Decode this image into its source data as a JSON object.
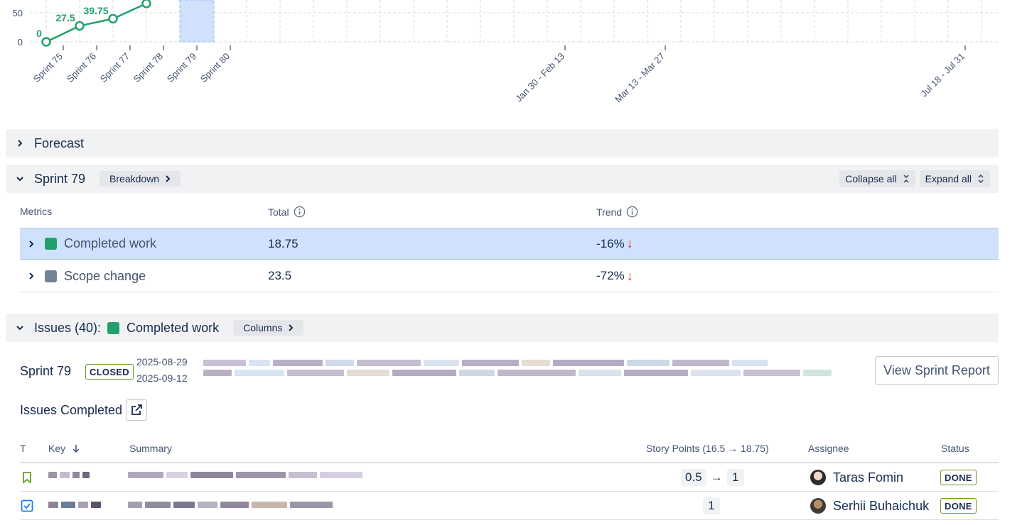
{
  "chart_data": {
    "type": "line",
    "series": [
      {
        "name": "Completed work",
        "color": "#22a06b",
        "x": [
          "Sprint 75",
          "Sprint 76",
          "Sprint 77",
          "Sprint 78"
        ],
        "y": [
          0,
          27.5,
          39.75,
          66
        ]
      }
    ],
    "data_labels": [
      "0",
      "27.5",
      "39.75"
    ],
    "y_ticks": [
      "0",
      "50"
    ],
    "x_tick_labels": [
      "Sprint 75",
      "Sprint 76",
      "Sprint 77",
      "Sprint 78",
      "Sprint 79",
      "Sprint 80",
      "Jan 30 - Feb 13",
      "Mar 13 - Mar 27",
      "Jul 18 - Jul 31"
    ],
    "highlighted_category": "Sprint 79",
    "grid": true
  },
  "forecast": {
    "title": "Forecast"
  },
  "sprint_panel": {
    "title": "Sprint 79",
    "breakdown_label": "Breakdown",
    "collapse_label": "Collapse all",
    "expand_label": "Expand all"
  },
  "metrics": {
    "headers": {
      "metrics": "Metrics",
      "total": "Total",
      "trend": "Trend"
    },
    "rows": [
      {
        "name": "Completed work",
        "total": "18.75",
        "trend": "-16%",
        "color": "#22a06b",
        "arrow": "↓"
      },
      {
        "name": "Scope change",
        "total": "23.5",
        "trend": "-72%",
        "color": "#758195",
        "arrow": "↓"
      }
    ]
  },
  "issues_panel": {
    "title": "Issues (40):",
    "metric_name": "Completed work",
    "columns_label": "Columns"
  },
  "sprint_info": {
    "name": "Sprint 79",
    "status": "CLOSED",
    "start_date": "2025-08-29",
    "end_date": "2025-09-12",
    "view_report_label": "View Sprint Report"
  },
  "issues_completed": {
    "title": "Issues Completed"
  },
  "table": {
    "headers": {
      "type": "T",
      "key": "Key",
      "summary": "Summary",
      "story_points": "Story Points (16.5 → 18.75)",
      "assignee": "Assignee",
      "status": "Status"
    },
    "rows": [
      {
        "type_icon": "bookmark-icon",
        "sp_from": "0.5",
        "sp_arrow": "→",
        "sp_to": "1",
        "assignee": "Taras Fomin",
        "status": "DONE"
      },
      {
        "type_icon": "checkbox-icon",
        "sp_to": "1",
        "assignee": "Serhii Buhaichuk",
        "status": "DONE"
      }
    ]
  }
}
